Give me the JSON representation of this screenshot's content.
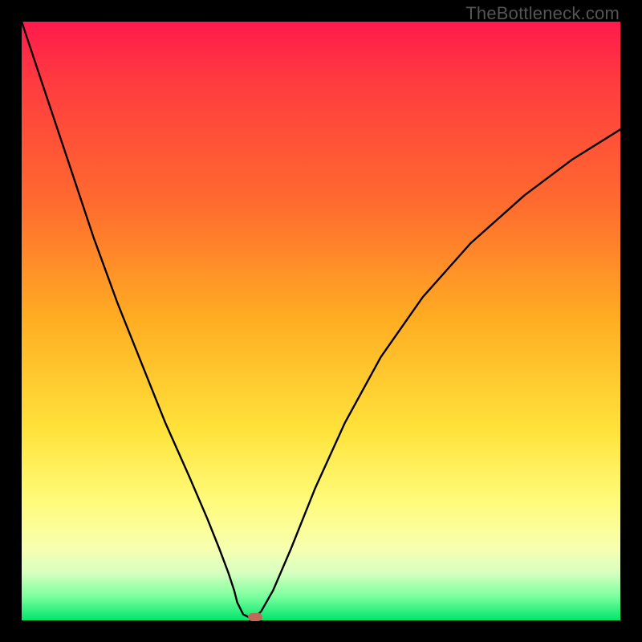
{
  "watermark": "TheBottleneck.com",
  "colors": {
    "frame": "#000000",
    "gradient_top": "#ff1a4d",
    "gradient_mid": "#ffe23a",
    "gradient_bottom": "#00e66b",
    "curve": "#000000",
    "marker": "#c06a5a"
  },
  "chart_data": {
    "type": "line",
    "title": "",
    "xlabel": "",
    "ylabel": "",
    "xlim": [
      0,
      100
    ],
    "ylim": [
      0,
      100
    ],
    "grid": false,
    "legend": false,
    "notch_x": 38,
    "marker": {
      "x": 39,
      "y": 0.6
    },
    "series": [
      {
        "name": "curve",
        "x": [
          0,
          4,
          8,
          12,
          16,
          20,
          24,
          28,
          31,
          33,
          34.5,
          35.5,
          36,
          36.5,
          37,
          38,
          39,
          40,
          42,
          45,
          49,
          54,
          60,
          67,
          75,
          84,
          92,
          100
        ],
        "y": [
          100,
          88,
          76,
          64,
          53,
          43,
          33,
          24,
          17,
          12,
          8,
          5,
          3,
          2,
          1,
          0.5,
          0.5,
          1.5,
          5,
          12,
          22,
          33,
          44,
          54,
          63,
          71,
          77,
          82
        ]
      }
    ]
  }
}
